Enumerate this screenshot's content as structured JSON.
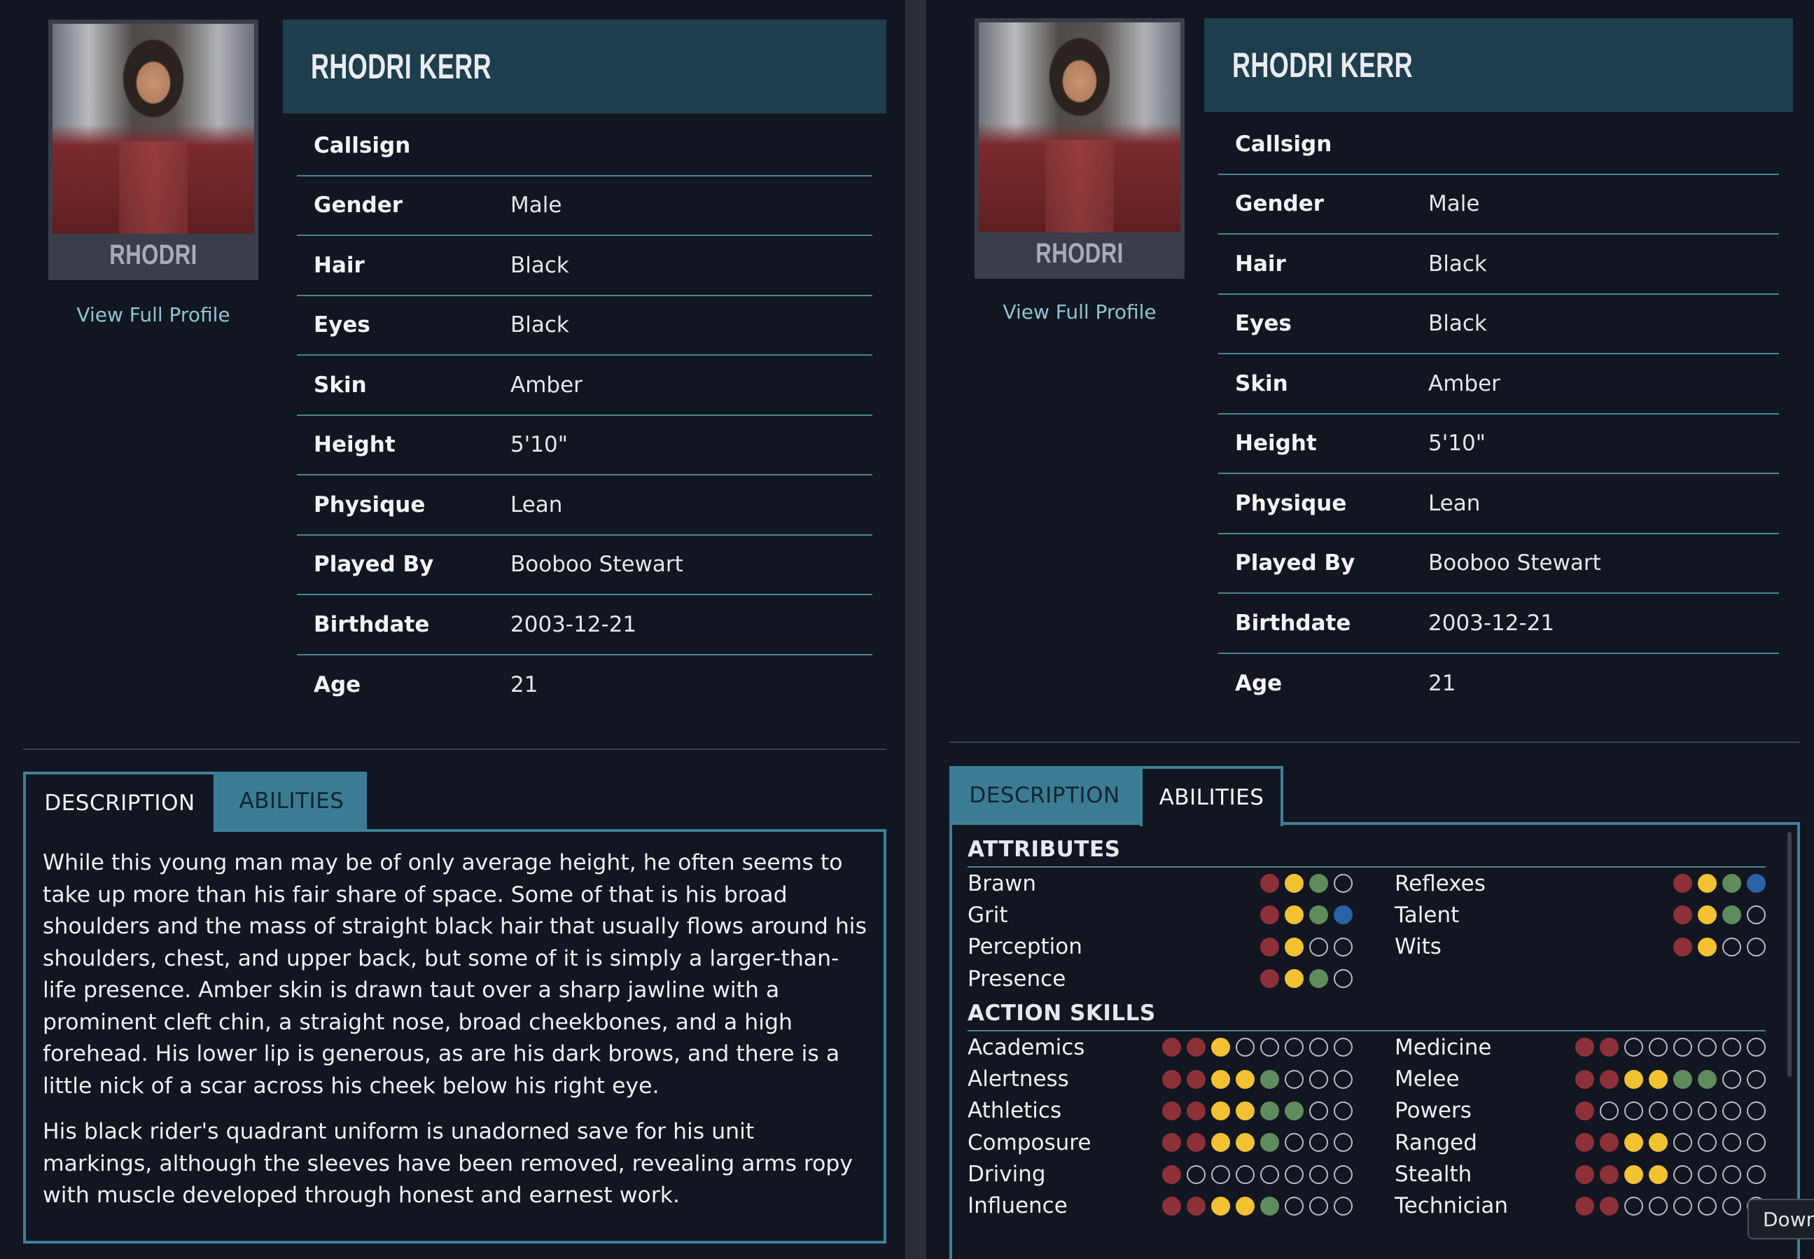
{
  "character": {
    "full_name": "RHODRI KERR",
    "portrait_name": "RHODRI",
    "profile_link": "View Full Profile"
  },
  "info": [
    {
      "label": "Callsign",
      "value": ""
    },
    {
      "label": "Gender",
      "value": "Male"
    },
    {
      "label": "Hair",
      "value": "Black"
    },
    {
      "label": "Eyes",
      "value": "Black"
    },
    {
      "label": "Skin",
      "value": "Amber"
    },
    {
      "label": "Height",
      "value": "5'10\""
    },
    {
      "label": "Physique",
      "value": "Lean"
    },
    {
      "label": "Played By",
      "value": "Booboo Stewart"
    },
    {
      "label": "Birthdate",
      "value": "2003-12-21"
    },
    {
      "label": "Age",
      "value": "21"
    }
  ],
  "tabs": {
    "description": "DESCRIPTION",
    "abilities": "ABILITIES"
  },
  "description": [
    "While this young man may be of only average height, he often seems to take up more than his fair share of space. Some of that is his broad shoulders and the mass of straight black hair that usually flows around his shoulders, chest, and upper back, but some of it is simply a larger-than-life presence. Amber skin is drawn taut over a sharp jawline with a prominent cleft chin, a straight nose, broad cheekbones, and a high forehead. His lower lip is generous, as are his dark brows, and there is a little nick of a scar across his cheek below his right eye.",
    "His black rider's quadrant uniform is unadorned save for his unit markings, although the sleeves have been removed, revealing arms ropy with muscle developed through honest and earnest work."
  ],
  "abilities": {
    "attributes_heading": "ATTRIBUTES",
    "attributes": [
      {
        "name": "Brawn",
        "dots": [
          "red",
          "yellow",
          "green",
          "empty"
        ]
      },
      {
        "name": "Reflexes",
        "dots": [
          "red",
          "yellow",
          "green",
          "blue"
        ]
      },
      {
        "name": "Grit",
        "dots": [
          "red",
          "yellow",
          "green",
          "blue"
        ]
      },
      {
        "name": "Talent",
        "dots": [
          "red",
          "yellow",
          "green",
          "empty"
        ]
      },
      {
        "name": "Perception",
        "dots": [
          "red",
          "yellow",
          "empty",
          "empty"
        ]
      },
      {
        "name": "Wits",
        "dots": [
          "red",
          "yellow",
          "empty",
          "empty"
        ]
      },
      {
        "name": "Presence",
        "dots": [
          "red",
          "yellow",
          "green",
          "empty"
        ]
      }
    ],
    "skills_heading": "ACTION SKILLS",
    "skills": [
      {
        "name": "Academics",
        "dots": [
          "red",
          "red",
          "yellow",
          "empty",
          "empty",
          "empty",
          "empty",
          "empty"
        ]
      },
      {
        "name": "Medicine",
        "dots": [
          "red",
          "red",
          "empty",
          "empty",
          "empty",
          "empty",
          "empty",
          "empty"
        ]
      },
      {
        "name": "Alertness",
        "dots": [
          "red",
          "red",
          "yellow",
          "yellow",
          "green",
          "empty",
          "empty",
          "empty"
        ]
      },
      {
        "name": "Melee",
        "dots": [
          "red",
          "red",
          "yellow",
          "yellow",
          "green",
          "green",
          "empty",
          "empty"
        ]
      },
      {
        "name": "Athletics",
        "dots": [
          "red",
          "red",
          "yellow",
          "yellow",
          "green",
          "green",
          "empty",
          "empty"
        ]
      },
      {
        "name": "Powers",
        "dots": [
          "red",
          "empty",
          "empty",
          "empty",
          "empty",
          "empty",
          "empty",
          "empty"
        ]
      },
      {
        "name": "Composure",
        "dots": [
          "red",
          "red",
          "yellow",
          "yellow",
          "green",
          "empty",
          "empty",
          "empty"
        ]
      },
      {
        "name": "Ranged",
        "dots": [
          "red",
          "red",
          "yellow",
          "yellow",
          "empty",
          "empty",
          "empty",
          "empty"
        ]
      },
      {
        "name": "Driving",
        "dots": [
          "red",
          "empty",
          "empty",
          "empty",
          "empty",
          "empty",
          "empty",
          "empty"
        ]
      },
      {
        "name": "Stealth",
        "dots": [
          "red",
          "red",
          "yellow",
          "yellow",
          "empty",
          "empty",
          "empty",
          "empty"
        ]
      },
      {
        "name": "Influence",
        "dots": [
          "red",
          "red",
          "yellow",
          "yellow",
          "green",
          "empty",
          "empty",
          "empty"
        ]
      },
      {
        "name": "Technician",
        "dots": [
          "red",
          "red",
          "empty",
          "empty",
          "empty",
          "empty",
          "empty",
          "empty"
        ]
      }
    ]
  },
  "download_label": "Down",
  "colors": {
    "background": "#121621",
    "header": "#1e3d4d",
    "accent": "#3e8197",
    "link": "#8fc3d2"
  }
}
